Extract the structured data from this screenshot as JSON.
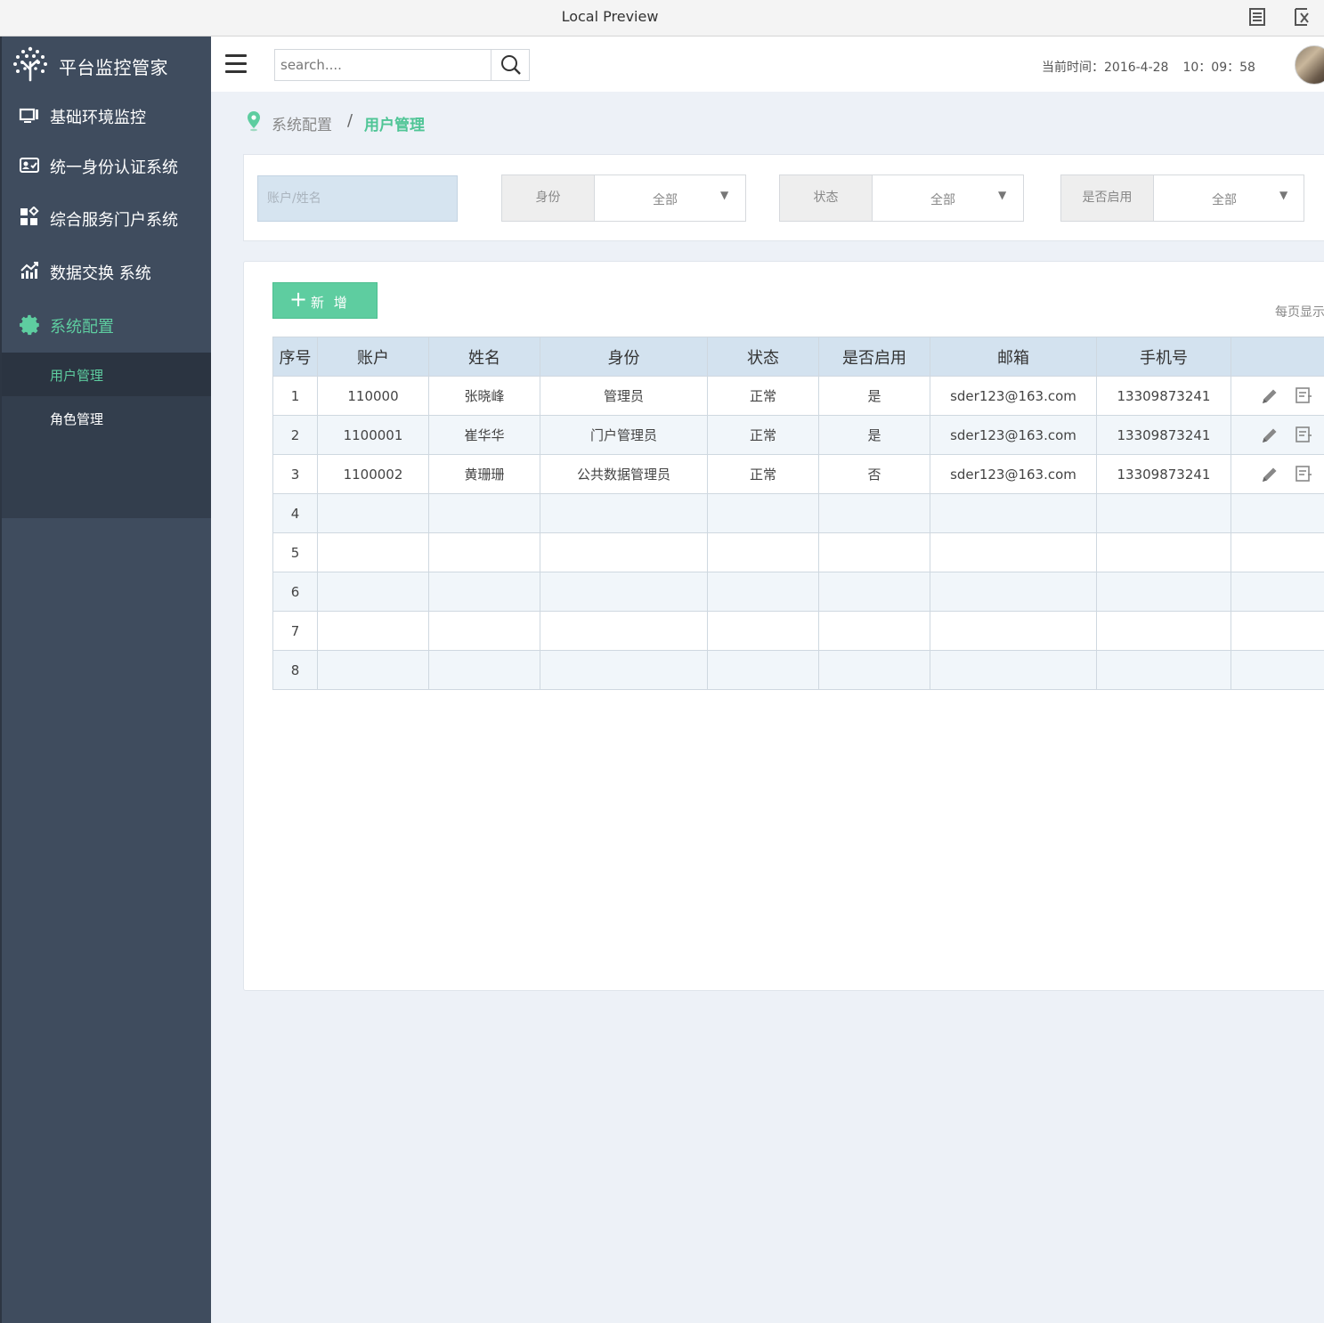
{
  "window": {
    "title": "Local Preview"
  },
  "brand": {
    "name": "平台监控管家"
  },
  "sidebar": {
    "items": [
      {
        "label": "基础环境监控",
        "icon": "monitor-icon"
      },
      {
        "label": "统一身份认证系统",
        "icon": "id-card-icon"
      },
      {
        "label": "综合服务门户系统",
        "icon": "apps-grid-icon"
      },
      {
        "label": "数据交换 系统",
        "icon": "chart-up-icon"
      },
      {
        "label": "系统配置",
        "icon": "gear-icon",
        "active": true
      }
    ],
    "submenu": [
      {
        "label": "用户管理",
        "active": true
      },
      {
        "label": "角色管理"
      }
    ]
  },
  "header": {
    "search_placeholder": "search....",
    "time_label": "当前时间：2016-4-28",
    "time_value": "10：09：58"
  },
  "breadcrumb": {
    "parent": "系统配置",
    "separator": "/",
    "current": "用户管理"
  },
  "filters": {
    "keyword_placeholder": "账户/姓名",
    "groups": [
      {
        "label": "身份",
        "value": "全部"
      },
      {
        "label": "状态",
        "value": "全部"
      },
      {
        "label": "是否启用",
        "value": "全部"
      }
    ]
  },
  "toolbar": {
    "add_label": "新 增",
    "per_page_label": "每页显示"
  },
  "table": {
    "columns": [
      "序号",
      "账户",
      "姓名",
      "身份",
      "状态",
      "是否启用",
      "邮箱",
      "手机号",
      ""
    ],
    "rows": [
      [
        "1",
        "110000",
        "张晓峰",
        "管理员",
        "正常",
        "是",
        "sder123@163.com",
        "13309873241"
      ],
      [
        "2",
        "1100001",
        "崔华华",
        "门户管理员",
        "正常",
        "是",
        "sder123@163.com",
        "13309873241"
      ],
      [
        "3",
        "1100002",
        "黄珊珊",
        "公共数据管理员",
        "正常",
        "否",
        "sder123@163.com",
        "13309873241"
      ],
      [
        "4",
        "",
        "",
        "",
        "",
        "",
        "",
        ""
      ],
      [
        "5",
        "",
        "",
        "",
        "",
        "",
        "",
        ""
      ],
      [
        "6",
        "",
        "",
        "",
        "",
        "",
        "",
        ""
      ],
      [
        "7",
        "",
        "",
        "",
        "",
        "",
        "",
        ""
      ],
      [
        "8",
        "",
        "",
        "",
        "",
        "",
        "",
        ""
      ]
    ],
    "row_actions": [
      "edit-pencil-icon",
      "detail-list-icon"
    ]
  },
  "colors": {
    "accent": "#5ecda0",
    "sidebar_bg": "#3f4c5e",
    "table_header_bg": "#d3e2ef"
  }
}
